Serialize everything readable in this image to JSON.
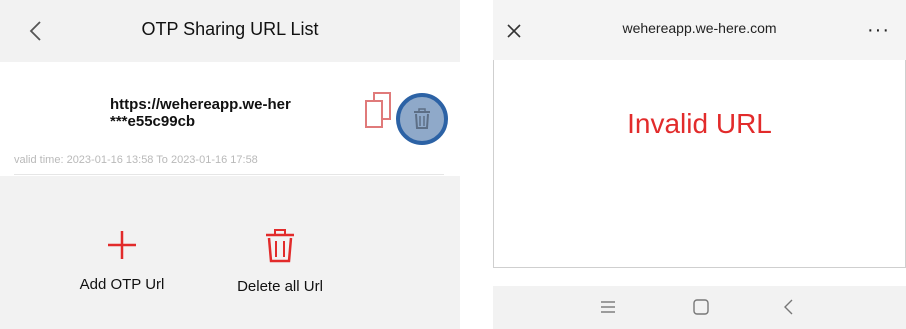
{
  "left": {
    "title": "OTP Sharing URL List",
    "back_icon": "chevron-left-icon",
    "item": {
      "url_text": "https://wehereapp.we-her\n***e55c99cb",
      "valid_time": "valid time: 2023-01-16 13:58 To 2023-01-16 17:58",
      "copy_icon": "copy-icon",
      "delete_icon": "trash-icon"
    },
    "actions": {
      "add_label": "Add OTP Url",
      "add_icon": "plus-icon",
      "delete_all_label": "Delete all Url",
      "delete_all_icon": "trash-icon"
    }
  },
  "right": {
    "url": "wehereapp.we-here.com",
    "close_icon": "close-icon",
    "more_label": "···",
    "message": "Invalid URL",
    "nav_icons": [
      "menu-icon",
      "home-icon",
      "back-icon"
    ]
  },
  "colors": {
    "accent_red": "#e22b2b",
    "icon_red": "#e07a7a",
    "highlight_blue": "#2c62a5",
    "highlight_fill": "#8fa9c9"
  }
}
